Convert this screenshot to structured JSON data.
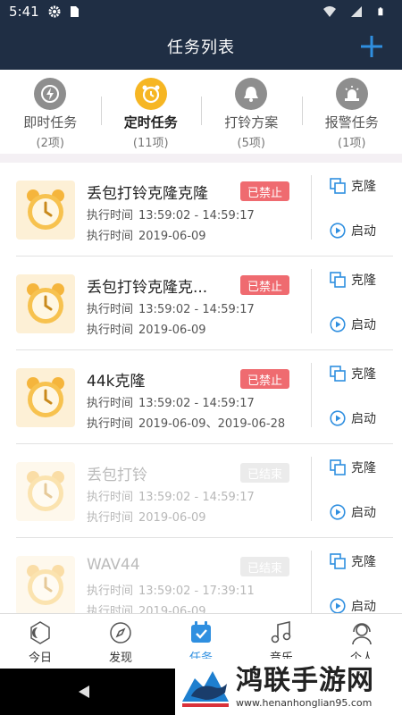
{
  "status_bar": {
    "time": "5:41"
  },
  "header": {
    "title": "任务列表",
    "add_label": "+"
  },
  "tabs": [
    {
      "label": "即时任务",
      "count": "(2项)",
      "icon": "lightning-icon",
      "active": false
    },
    {
      "label": "定时任务",
      "count": "(11项)",
      "icon": "alarm-clock-icon",
      "active": true
    },
    {
      "label": "打铃方案",
      "count": "(5项)",
      "icon": "bell-icon",
      "active": false
    },
    {
      "label": "报警任务",
      "count": "(1项)",
      "icon": "siren-icon",
      "active": false
    }
  ],
  "task_labels": {
    "exec_time": "执行时间",
    "clone": "克隆",
    "start": "启动"
  },
  "tasks": [
    {
      "name": "丢包打铃克隆克隆",
      "status": "已禁止",
      "time": "13:59:02 - 14:59:17",
      "date": "2019-06-09"
    },
    {
      "name": "丢包打铃克隆克...",
      "status": "已禁止",
      "time": "13:59:02 - 14:59:17",
      "date": "2019-06-09"
    },
    {
      "name": "44k克隆",
      "status": "已禁止",
      "time": "13:59:02 - 14:59:17",
      "date": "2019-06-09、2019-06-28"
    },
    {
      "name": "丢包打铃",
      "status": "已结束",
      "time": "13:59:02 - 14:59:17",
      "date": "2019-06-09"
    },
    {
      "name": "WAV44",
      "status": "已结束",
      "time": "13:59:02 - 17:39:11",
      "date": "2019-06-09"
    }
  ],
  "bottom_nav": [
    {
      "label": "今日",
      "icon": "today-icon"
    },
    {
      "label": "发现",
      "icon": "compass-icon"
    },
    {
      "label": "任务",
      "icon": "calendar-check-icon"
    },
    {
      "label": "音乐",
      "icon": "music-note-icon"
    },
    {
      "label": "个人",
      "icon": "headset-user-icon"
    }
  ],
  "watermark": {
    "title": "鸿联手游网",
    "url": "www.henanhonglian95.com"
  },
  "colors": {
    "header_bg": "#1f2e44",
    "accent": "#2f8fe0",
    "badge_disabled": "#ef6b70",
    "active_tab_icon": "#f6b623"
  }
}
